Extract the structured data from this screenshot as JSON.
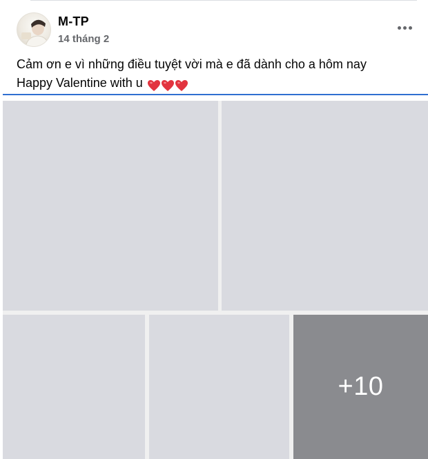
{
  "post": {
    "author": "M-TP",
    "date": "14 tháng 2",
    "caption_line1": "Cảm ơn e vì những điều tuyệt vời mà e đã dành cho a hôm nay",
    "caption_line2": "Happy Valentine with u",
    "hearts": [
      "heart-emoji",
      "heart-emoji",
      "heart-emoji"
    ],
    "photos": {
      "visible_count": 5,
      "more_count_label": "+10"
    }
  },
  "colors": {
    "heart": "#e2343f",
    "divider": "#2f6fd1",
    "placeholder": "#d9dae0",
    "overlay": "#8a8b8f"
  }
}
